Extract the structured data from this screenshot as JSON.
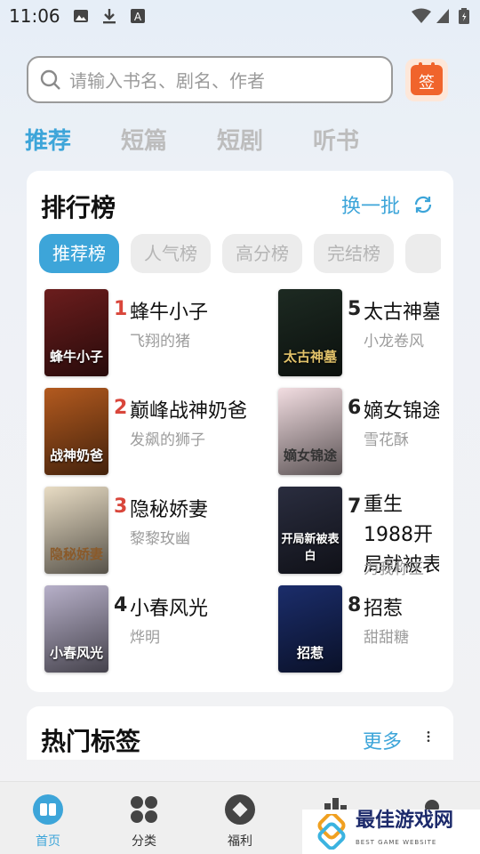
{
  "status": {
    "time": "11:06"
  },
  "search": {
    "placeholder": "请输入书名、剧名、作者"
  },
  "checkin": {
    "label": "签"
  },
  "tabs": [
    "推荐",
    "短篇",
    "短剧",
    "听书"
  ],
  "ranking": {
    "title": "排行榜",
    "refresh_label": "换一批",
    "chips": [
      "推荐榜",
      "人气榜",
      "高分榜",
      "完结榜"
    ],
    "books": [
      {
        "rank": "1",
        "title": "蜂牛小子",
        "author": "飞翔的猪",
        "cover_text": "蜂牛小子",
        "cover_color": "#6b1d1d"
      },
      {
        "rank": "2",
        "title": "巅峰战神奶爸",
        "author": "发飙的狮子",
        "cover_text": "战神奶爸",
        "cover_color": "#b35a1f"
      },
      {
        "rank": "3",
        "title": "隐秘娇妻",
        "author": "黎黎玫幽",
        "cover_text": "隐秘娇妻",
        "cover_color": "#e8dcc4"
      },
      {
        "rank": "4",
        "title": "小春风光",
        "author": "烨明",
        "cover_text": "小春风光",
        "cover_color": "#b7b0c9"
      },
      {
        "rank": "5",
        "title": "太古神墓",
        "author": "小龙卷风",
        "cover_text": "太古神墓",
        "cover_color": "#1d2a22"
      },
      {
        "rank": "6",
        "title": "嫡女锦途",
        "author": "雪花酥",
        "cover_text": "嫡女锦途",
        "cover_color": "#f2dde1"
      },
      {
        "rank": "7",
        "title": "重生1988开局就被表",
        "author": "为我称王",
        "cover_text": "开局新被表白",
        "cover_color": "#2a2d3f"
      },
      {
        "rank": "8",
        "title": "招惹",
        "author": "甜甜糖",
        "cover_text": "招惹",
        "cover_color": "#1b2d6b"
      }
    ]
  },
  "hot_tags": {
    "title": "热门标签",
    "more_label": "更多"
  },
  "navbar": [
    {
      "label": "首页"
    },
    {
      "label": "分类"
    },
    {
      "label": "福利"
    },
    {
      "label": ""
    },
    {
      "label": ""
    }
  ],
  "watermark": {
    "text": "最佳游戏网",
    "sub": "BEST GAME WEBSITE"
  },
  "colors": {
    "accent": "#3da5d9",
    "rank_top": "#d9463b",
    "checkin": "#f0642c"
  }
}
